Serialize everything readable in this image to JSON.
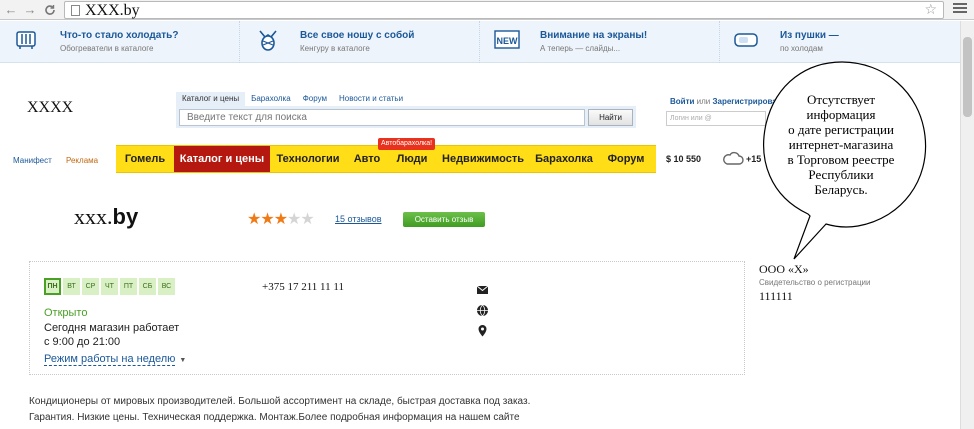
{
  "browser": {
    "url": "XXX.by",
    "back_glyph": "←",
    "forward_glyph": "→",
    "reload_glyph": "C"
  },
  "promo": [
    {
      "title": "Что-то стало холодать?",
      "sub": "Обогреватели в каталоге",
      "icon": "heater-icon"
    },
    {
      "title": "Все свое ношу с собой",
      "sub": "Кенгуру в каталоге",
      "icon": "baby-carrier-icon"
    },
    {
      "title": "Внимание на экраны!",
      "sub": "А теперь — слайды...",
      "icon": "new-screen-icon",
      "icon_text": "NEW"
    },
    {
      "title": "Из пушки —",
      "sub": "по холодам",
      "icon": "heat-gun-icon"
    }
  ],
  "header": {
    "logo": "XXXX",
    "search_tabs": [
      "Каталог и цены",
      "Барахолка",
      "Форум",
      "Новости и статьи"
    ],
    "search_placeholder": "Введите текст для поиска",
    "search_button": "Найти",
    "login_link": "Войти",
    "login_or": " или ",
    "register_link": "Зарегистрироваться",
    "login_placeholder": "Логин или @"
  },
  "nav": {
    "manifest": "Манифест",
    "ads": "Реклама",
    "items": [
      "Гомель",
      "Каталог и цены",
      "Технологии",
      "Авто",
      "Люди",
      "Недвижимость",
      "Барахолка",
      "Форум"
    ],
    "badge": "Автобарахолка!",
    "rate": "$ 10 550",
    "temp": "+15"
  },
  "shop": {
    "name_part1": "xxx.",
    "name_part2": "by",
    "rating": 3,
    "rating_max": 5,
    "reviews": "15 отзывов",
    "review_button": "Оставить отзыв"
  },
  "info": {
    "days": [
      "ПН",
      "ВТ",
      "СР",
      "ЧТ",
      "ПТ",
      "СБ",
      "ВС"
    ],
    "status": "Открыто",
    "hours_line1": "Сегодня магазин работает",
    "hours_line2": "с 9:00 до 21:00",
    "schedule_link": "Режим работы на неделю",
    "phone": "+375 17 211 11 11",
    "company": "ООО «Х»",
    "cert_label": "Свидетельство о регистрации",
    "cert_number": "111111"
  },
  "description": {
    "line1": "Кондиционеры от мировых производителей. Большой ассортимент на складе, быстрая доставка под заказ.",
    "line2": "Гарантия. Низкие цены. Техническая поддержка. Монтаж.Более подробная информация на нашем сайте"
  },
  "callout": {
    "lines": [
      "Отсутствует",
      "информация",
      "о дате регистрации",
      "интернет-магазина",
      "в Торговом реестре",
      "Республики",
      "Беларусь."
    ]
  },
  "colors": {
    "nav_bg": "#ffde17",
    "nav_active": "#b5180f",
    "link": "#1b5899",
    "open_green": "#4aa025",
    "review_btn": "#4aa629",
    "star_on": "#f07a16"
  }
}
